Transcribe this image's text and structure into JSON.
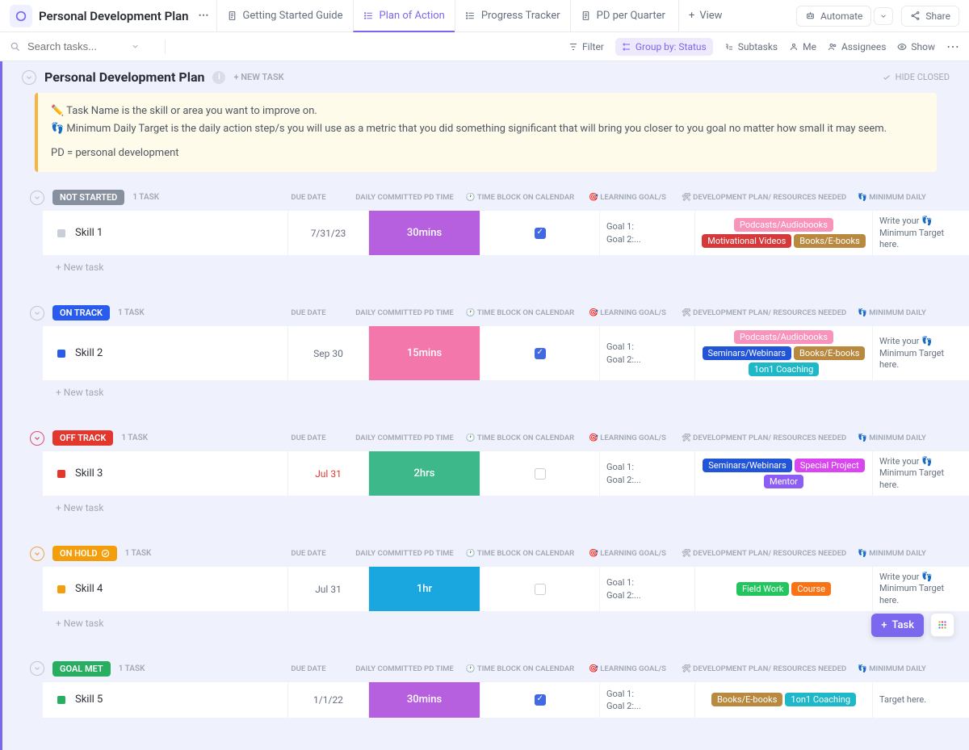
{
  "header": {
    "title": "Personal Development Plan",
    "tabs": [
      {
        "label": "Getting Started Guide",
        "icon": "doc"
      },
      {
        "label": "Plan of Action",
        "icon": "list",
        "active": true
      },
      {
        "label": "Progress Tracker",
        "icon": "list"
      },
      {
        "label": "PD per Quarter",
        "icon": "doc"
      }
    ],
    "add_view": "View",
    "automate": "Automate",
    "share": "Share"
  },
  "toolbar": {
    "search_placeholder": "Search tasks...",
    "filter": "Filter",
    "group_by": "Group by: Status",
    "subtasks": "Subtasks",
    "me": "Me",
    "assignees": "Assignees",
    "show": "Show"
  },
  "list": {
    "title": "Personal Development Plan",
    "new_task": "+ NEW TASK",
    "hide_closed": "HIDE CLOSED"
  },
  "note": {
    "line1": "Task Name is the skill or area you want to improve on.",
    "line2": "Minimum Daily Target is the daily action step/s you will use as a metric that you did something significant that will bring you closer to you goal no matter how small it may seem.",
    "line3": "PD = personal development"
  },
  "columns": {
    "due": "DUE DATE",
    "time": "DAILY COMMITTED PD TIME",
    "block": "🕐 TIME BLOCK ON CALENDAR",
    "goals": "🎯 LEARNING GOAL/S",
    "plan": "🛠 DEVELOPMENT PLAN/ RESOURCES NEEDED",
    "min": "👣 MINIMUM DAILY"
  },
  "new_task_row": "+ New task",
  "groups": [
    {
      "status": "NOT STARTED",
      "status_class": "status-notstarted",
      "sq": "sq-grey",
      "count": "1 TASK",
      "caret": "",
      "tasks": [
        {
          "name": "Skill 1",
          "due": "7/31/23",
          "due_red": false,
          "time": "30mins",
          "time_class": "time-purple",
          "checked": true,
          "goals1": "Goal 1:",
          "goals2": "Goal 2:...",
          "tags": [
            {
              "text": "Podcasts/Audiobooks",
              "cls": "tag-podcasts"
            },
            {
              "text": "Motivational Videos",
              "cls": "tag-motvid"
            },
            {
              "text": "Books/E-books",
              "cls": "tag-books"
            }
          ],
          "min": "Write your 👣 Minimum Target here."
        }
      ]
    },
    {
      "status": "ON TRACK",
      "status_class": "status-ontrack",
      "sq": "sq-blue",
      "count": "1 TASK",
      "caret": "",
      "tasks": [
        {
          "name": "Skill 2",
          "due": "Sep 30",
          "due_red": false,
          "time": "15mins",
          "time_class": "time-pink",
          "checked": true,
          "goals1": "Goal 1:",
          "goals2": "Goal 2:...",
          "tags": [
            {
              "text": "Podcasts/Audiobooks",
              "cls": "tag-podcasts"
            },
            {
              "text": "Seminars/Webinars",
              "cls": "tag-seminars"
            },
            {
              "text": "Books/E-books",
              "cls": "tag-books"
            },
            {
              "text": "1on1 Coaching",
              "cls": "tag-coaching"
            }
          ],
          "min": "Write your 👣 Minimum Target here."
        }
      ]
    },
    {
      "status": "OFF TRACK",
      "status_class": "status-offtrack",
      "sq": "sq-red",
      "count": "1 TASK",
      "caret": "red",
      "tasks": [
        {
          "name": "Skill 3",
          "due": "Jul 31",
          "due_red": true,
          "time": "2hrs",
          "time_class": "time-green",
          "checked": false,
          "goals1": "Goal 1:",
          "goals2": "Goal 2:...",
          "tags": [
            {
              "text": "Seminars/Webinars",
              "cls": "tag-seminars"
            },
            {
              "text": "Special Project",
              "cls": "tag-special"
            },
            {
              "text": "Mentor",
              "cls": "tag-mentor"
            }
          ],
          "min": "Write your 👣 Minimum Target here."
        }
      ]
    },
    {
      "status": "ON HOLD",
      "status_class": "status-onhold",
      "sq": "sq-orange",
      "count": "1 TASK",
      "caret": "orange",
      "has_check_icon": true,
      "tasks": [
        {
          "name": "Skill 4",
          "due": "Jul 31",
          "due_red": false,
          "time": "1hr",
          "time_class": "time-blue",
          "checked": false,
          "goals1": "Goal 1:",
          "goals2": "Goal 2:...",
          "tags": [
            {
              "text": "Field Work",
              "cls": "tag-fieldwork"
            },
            {
              "text": "Course",
              "cls": "tag-course"
            }
          ],
          "min": "Write your 👣 Minimum Target here."
        }
      ]
    },
    {
      "status": "GOAL MET",
      "status_class": "status-goalmet",
      "sq": "sq-green",
      "count": "1 TASK",
      "caret": "",
      "no_new_task": true,
      "tasks": [
        {
          "name": "Skill 5",
          "due": "1/1/22",
          "due_red": false,
          "time": "30mins",
          "time_class": "time-purple",
          "checked": true,
          "goals1": "Goal 1:",
          "goals2": "Goal 2:...",
          "tags": [
            {
              "text": "Books/E-books",
              "cls": "tag-books"
            },
            {
              "text": "1on1 Coaching",
              "cls": "tag-coaching"
            }
          ],
          "min": "Target here."
        }
      ]
    }
  ],
  "fab": {
    "task": "Task"
  }
}
